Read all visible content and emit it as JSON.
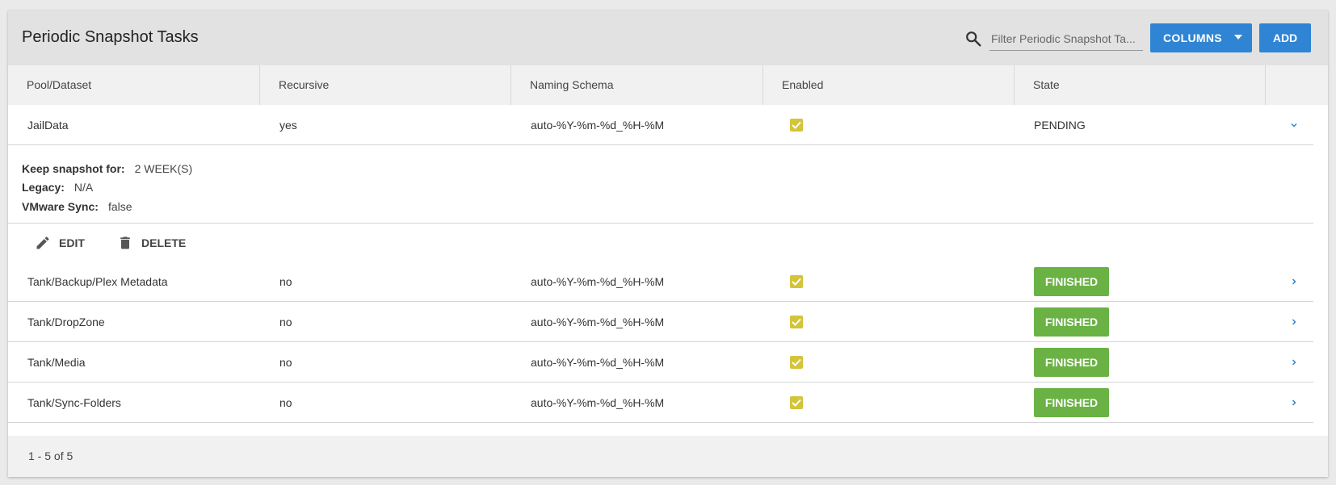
{
  "header": {
    "title": "Periodic Snapshot Tasks",
    "search_placeholder": "Filter Periodic Snapshot Ta...",
    "columns_button": "COLUMNS",
    "add_button": "ADD"
  },
  "table": {
    "columns": [
      "Pool/Dataset",
      "Recursive",
      "Naming Schema",
      "Enabled",
      "State"
    ],
    "rows": [
      {
        "dataset": "JailData",
        "recursive": "yes",
        "naming_schema": "auto-%Y-%m-%d_%H-%M",
        "enabled": true,
        "state": "PENDING",
        "expanded": true
      },
      {
        "dataset": "Tank/Backup/Plex Metadata",
        "recursive": "no",
        "naming_schema": "auto-%Y-%m-%d_%H-%M",
        "enabled": true,
        "state": "FINISHED",
        "expanded": false
      },
      {
        "dataset": "Tank/DropZone",
        "recursive": "no",
        "naming_schema": "auto-%Y-%m-%d_%H-%M",
        "enabled": true,
        "state": "FINISHED",
        "expanded": false
      },
      {
        "dataset": "Tank/Media",
        "recursive": "no",
        "naming_schema": "auto-%Y-%m-%d_%H-%M",
        "enabled": true,
        "state": "FINISHED",
        "expanded": false
      },
      {
        "dataset": "Tank/Sync-Folders",
        "recursive": "no",
        "naming_schema": "auto-%Y-%m-%d_%H-%M",
        "enabled": true,
        "state": "FINISHED",
        "expanded": false
      }
    ]
  },
  "details": {
    "keep_label": "Keep snapshot for:",
    "keep_value": "2 WEEK(S)",
    "legacy_label": "Legacy:",
    "legacy_value": "N/A",
    "vmware_label": "VMware Sync:",
    "vmware_value": "false"
  },
  "actions": {
    "edit": "EDIT",
    "delete": "DELETE"
  },
  "footer": {
    "range": "1 - 5 of 5"
  },
  "colors": {
    "primary": "#2f84d3",
    "finished": "#6ab244",
    "checkbox": "#d4c43a",
    "header_bg": "#e2e2e2"
  }
}
